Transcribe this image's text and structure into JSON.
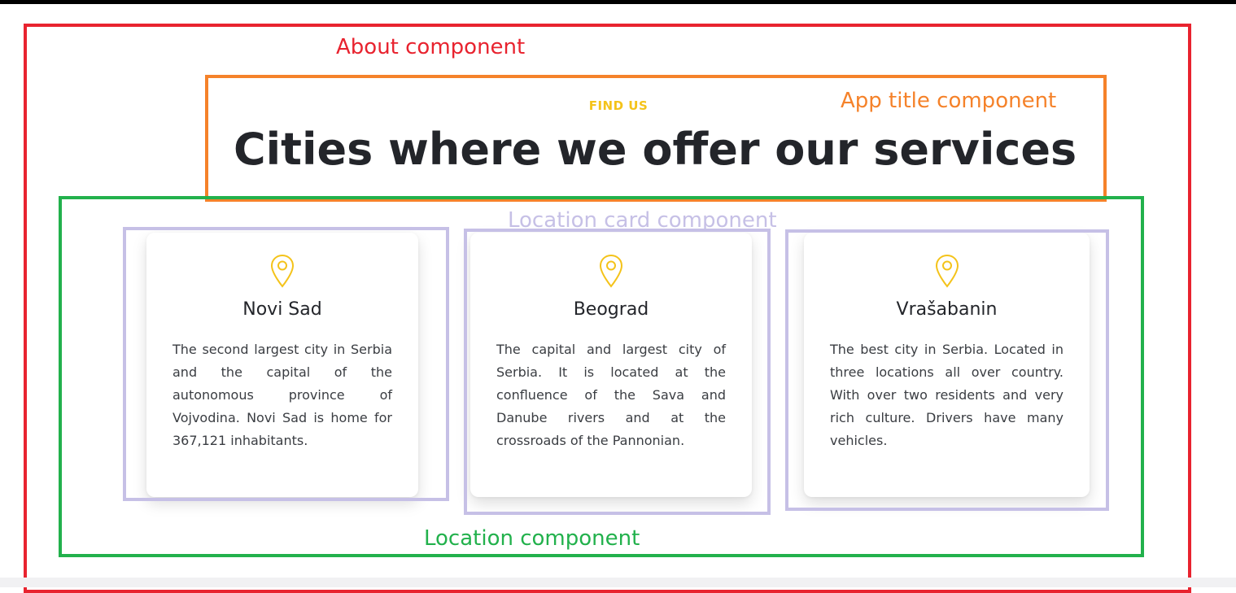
{
  "annotations": {
    "about": "About component",
    "app_title": "App title component",
    "location": "Location component",
    "location_card": "Location card component"
  },
  "header": {
    "eyebrow": "FIND US",
    "title": "Cities where we offer our services"
  },
  "cities": [
    {
      "name": "Novi Sad",
      "description": "The second largest city in Serbia and the capital of the autonomous province of Vojvodina. Novi Sad is home for 367,121 inhabitants."
    },
    {
      "name": "Beograd",
      "description": "The capital and largest city of Serbia. It is located at the confluence of the Sava and Danube rivers and at the crossroads of the Pannonian."
    },
    {
      "name": "Vrašabanin",
      "description": "The best city in Serbia. Located in three locations all over country. With over two residents and very rich culture. Drivers have many vehicles."
    }
  ],
  "colors": {
    "accent": "#f4c31a",
    "about_outline": "#e8232f",
    "title_outline": "#f5822a",
    "location_outline": "#22b14c",
    "card_outline": "#c6c0e6"
  },
  "icons": {
    "card_icon": "map-pin-icon"
  }
}
